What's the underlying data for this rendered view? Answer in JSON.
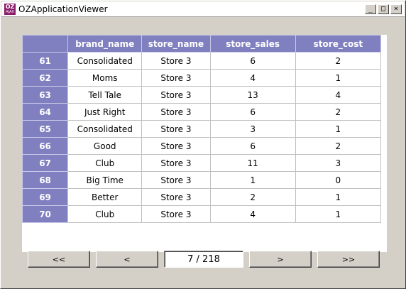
{
  "window": {
    "title": "OZApplicationViewer",
    "icon_text": "OZ",
    "icon_subtext": "AJAX",
    "controls": {
      "minimize": "_",
      "maximize": "□",
      "close": "×"
    }
  },
  "table": {
    "columns": [
      "",
      "brand_name",
      "store_name",
      "store_sales",
      "store_cost"
    ],
    "rows": [
      {
        "num": "61",
        "brand_name": "Consolidated",
        "store_name": "Store 3",
        "store_sales": "6",
        "store_cost": "2"
      },
      {
        "num": "62",
        "brand_name": "Moms",
        "store_name": "Store 3",
        "store_sales": "4",
        "store_cost": "1"
      },
      {
        "num": "63",
        "brand_name": "Tell Tale",
        "store_name": "Store 3",
        "store_sales": "13",
        "store_cost": "4"
      },
      {
        "num": "64",
        "brand_name": "Just Right",
        "store_name": "Store 3",
        "store_sales": "6",
        "store_cost": "2"
      },
      {
        "num": "65",
        "brand_name": "Consolidated",
        "store_name": "Store 3",
        "store_sales": "3",
        "store_cost": "1"
      },
      {
        "num": "66",
        "brand_name": "Good",
        "store_name": "Store 3",
        "store_sales": "6",
        "store_cost": "2"
      },
      {
        "num": "67",
        "brand_name": "Club",
        "store_name": "Store 3",
        "store_sales": "11",
        "store_cost": "3"
      },
      {
        "num": "68",
        "brand_name": "Big Time",
        "store_name": "Store 3",
        "store_sales": "1",
        "store_cost": "0"
      },
      {
        "num": "69",
        "brand_name": "Better",
        "store_name": "Store 3",
        "store_sales": "2",
        "store_cost": "1"
      },
      {
        "num": "70",
        "brand_name": "Club",
        "store_name": "Store 3",
        "store_sales": "4",
        "store_cost": "1"
      }
    ]
  },
  "nav": {
    "first": "<<",
    "prev": "<",
    "page": "7 / 218",
    "next": ">",
    "last": ">>"
  },
  "colors": {
    "header_bg": "#8080c0",
    "header_text": "#ffffff",
    "window_bg": "#d4d0c8"
  }
}
